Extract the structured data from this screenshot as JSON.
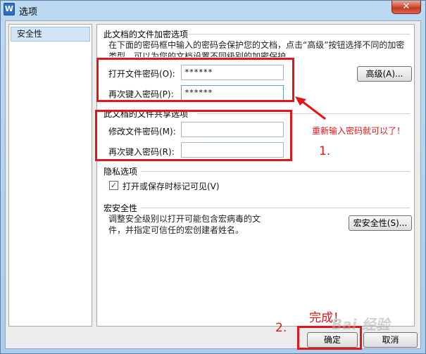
{
  "window": {
    "title": "选项",
    "app_icon_letter": "W",
    "close_label": "✕"
  },
  "nav": {
    "items": [
      {
        "label": "安全性"
      }
    ]
  },
  "encrypt": {
    "title": "此文档的文件加密选项",
    "desc_line1": "在下面的密码框中输入的密码会保护您的文档，点击“高级”按钮选择不同的加密",
    "desc_line2": "类型，可以为您的文档设置不同级别的加密保护。",
    "open_password_label": "打开文件密码(O):",
    "open_password_value": "******",
    "confirm_open_label": "再次键入密码(P):",
    "confirm_open_value": "******",
    "advanced_button": "高级(A)..."
  },
  "share": {
    "title": "此文档的文件共享选项",
    "modify_password_label": "修改文件密码(M):",
    "modify_password_value": "",
    "confirm_modify_label": "再次键入密码(R):",
    "confirm_modify_value": ""
  },
  "privacy": {
    "title": "隐私选项",
    "checkbox_label": "打开或保存时标记可见(V)",
    "checked": true
  },
  "macro": {
    "title": "宏安全性",
    "desc_line1": "调整安全级别以打开可能包含宏病毒的文",
    "desc_line2": "件，并指定可信任的宏创建者姓名。",
    "button": "宏安全性(S)..."
  },
  "footer": {
    "ok_button": "确定",
    "cancel_button": "取消"
  },
  "annotations": {
    "retype_hint": "重新输入密码就可以了！",
    "step1": "1.",
    "step2": "2.",
    "done": "完成！",
    "color": "#e0171b"
  },
  "watermark": "Bai 经验"
}
